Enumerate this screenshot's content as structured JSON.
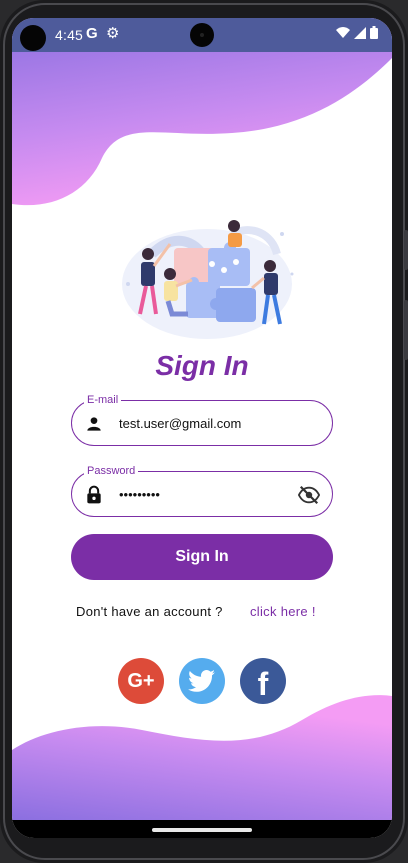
{
  "status_bar": {
    "time": "4:45",
    "g_icon": "google-icon",
    "settings_icon": "gear-icon",
    "icons": [
      "wifi-icon",
      "signal-icon",
      "battery-icon"
    ]
  },
  "form": {
    "title": "Sign In",
    "email": {
      "label": "E-mail",
      "value": "test.user@gmail.com",
      "icon": "person-icon"
    },
    "password": {
      "label": "Password",
      "value": "•••••••••",
      "icon": "lock-icon",
      "toggle_icon": "eye-off-icon"
    },
    "submit_label": "Sign In",
    "signup_prompt": "Don't have an account ?",
    "signup_link": "click here !"
  },
  "social": [
    {
      "name": "google-plus",
      "glyph": "G+",
      "color": "#dd4b39"
    },
    {
      "name": "twitter",
      "glyph": "",
      "color": "#55acee"
    },
    {
      "name": "facebook",
      "glyph": "f",
      "color": "#3b5998"
    }
  ],
  "colors": {
    "accent": "#7b2ea6",
    "wave_purple": "#9b6fe0",
    "wave_pink": "#f28fe6"
  }
}
